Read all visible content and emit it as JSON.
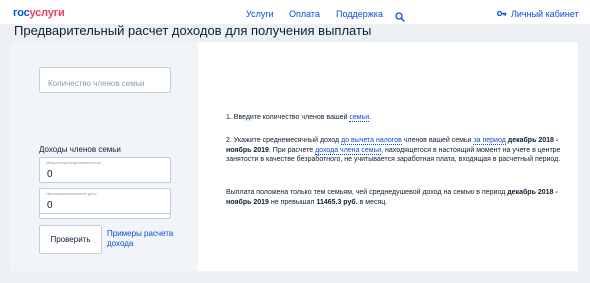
{
  "header": {
    "logo_part1": "гос",
    "logo_part2": "услуги",
    "nav": [
      "Услуги",
      "Оплата",
      "Поддержка"
    ],
    "account_label": "Личный кабинет"
  },
  "page": {
    "title": "Предварительный расчет доходов для получения выплаты"
  },
  "form": {
    "family_count_placeholder": "Количество членов семьи",
    "family_income_label": "Доходы членов семьи",
    "members": [
      {
        "label": "Мать/отец/опекун/попечитель",
        "value": "0"
      },
      {
        "label": "Отец/опекун/попечитель",
        "value": "0"
      },
      {
        "label": "Несовершеннолетние дети",
        "value": "0"
      }
    ],
    "check_button": "Проверить",
    "examples_link": "Примеры расчета дохода"
  },
  "info": {
    "step1_text": "1. Введите количество членов вашей ",
    "step1_link": "семьи",
    "step1_end": ".",
    "step2_a": "2. Укажите среднемесячный доход ",
    "step2_link1": "до вычета налогов",
    "step2_b": " членов вашей семьи ",
    "step2_link2": "за период",
    "step2_period": "декабрь 2018 - ноябрь 2019",
    "step2_c": ". При расчете ",
    "step2_link3": "дохода члена семьи",
    "step2_d": ", находящегося в настоящий момент на учете в центре занятости в качестве безработного, не учитывается заработная плата, входящая в расчетный период.",
    "note_a": "Выплата положена только тем семьям, чей среднедушевой доход на семью в период ",
    "note_period": "декабрь 2018 - ноябрь 2019",
    "note_b": " не превышал ",
    "note_amount": "11465.3 руб.",
    "note_c": " в месяц."
  }
}
